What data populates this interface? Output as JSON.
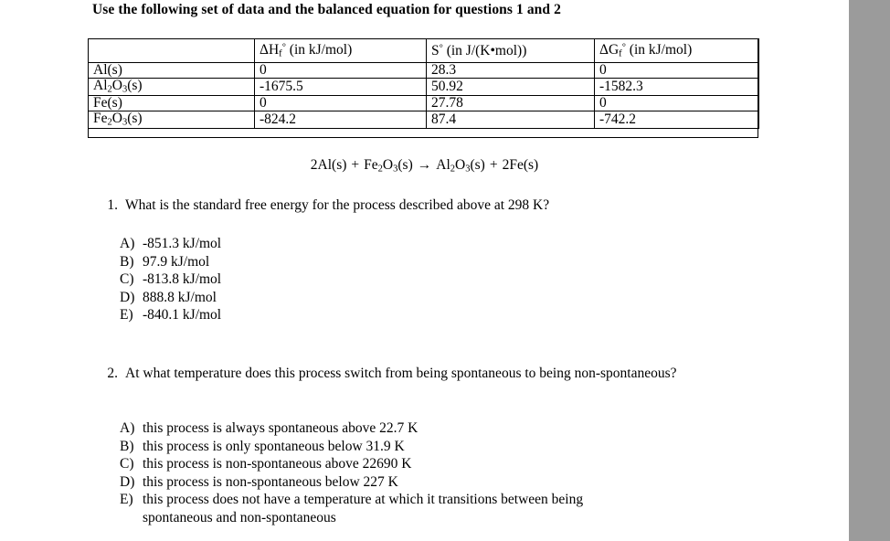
{
  "document": {
    "heading": "Use the following set of data and the balanced equation for questions 1 and 2",
    "gray_bar_color": "#9b9b9b",
    "background_color": "#ffffff",
    "text_color": "#000000"
  },
  "table": {
    "headers": [
      "",
      "ΔHf° (in kJ/mol)",
      "S° (in J/(K•mol))",
      "ΔGf° (in kJ/mol)"
    ],
    "header_parts": {
      "col0": "",
      "col1": {
        "symbol": "ΔH",
        "sub": "f",
        "sup": "°",
        "units": " (in kJ/mol)"
      },
      "col2": {
        "symbol": "S",
        "sub": "",
        "sup": "°",
        "units": "  (in J/(K•mol))"
      },
      "col3": {
        "symbol": "ΔG",
        "sub": "f",
        "sup": "°",
        "units": " (in kJ/mol)"
      }
    },
    "rows": [
      {
        "species_plain": "Al(s)",
        "species": {
          "pre": "Al(s)",
          "sub": "",
          "post": ""
        },
        "dHf": "0",
        "S": "28.3",
        "dGf": "0"
      },
      {
        "species_plain": "Al2O3(s)",
        "species": {
          "pre": "Al",
          "sub": "2",
          "mid": "O",
          "sub2": "3",
          "post": "(s)"
        },
        "dHf": "-1675.5",
        "S": "50.92",
        "dGf": "-1582.3"
      },
      {
        "species_plain": "Fe(s)",
        "species": {
          "pre": "Fe(s)",
          "sub": "",
          "post": ""
        },
        "dHf": "0",
        "S": "27.78",
        "dGf": "0"
      },
      {
        "species_plain": "Fe2O3(s)",
        "species": {
          "pre": "Fe",
          "sub": "2",
          "mid": "O",
          "sub2": "3",
          "post": "(s)"
        },
        "dHf": "-824.2",
        "S": "87.4",
        "dGf": "-742.2"
      }
    ]
  },
  "equation": {
    "full": "2Al(s)  +  Fe2O3(s) → Al2O3(s)  +  2Fe(s)",
    "r1_pre": "2Al(s)",
    "plus1": "+",
    "r2_pre": "Fe",
    "r2_sub1": "2",
    "r2_mid": "O",
    "r2_sub2": "3",
    "r2_post": "(s)",
    "arrow": "→",
    "p1_pre": "Al",
    "p1_sub1": "2",
    "p1_mid": "O",
    "p1_sub2": "3",
    "p1_post": "(s)",
    "plus2": "+",
    "p2_pre": "2Fe(s)"
  },
  "questions": [
    {
      "number": "1.",
      "text": "What is the standard free energy for the process described above at 298 K?",
      "choices": [
        {
          "label": "A)",
          "text": "-851.3 kJ/mol"
        },
        {
          "label": "B)",
          "text": "97.9 kJ/mol"
        },
        {
          "label": "C)",
          "text": "-813.8 kJ/mol"
        },
        {
          "label": "D)",
          "text": "888.8 kJ/mol"
        },
        {
          "label": "E)",
          "text": "-840.1 kJ/mol"
        }
      ]
    },
    {
      "number": "2.",
      "text": "At what temperature does this process switch from being spontaneous to being non-spontaneous?",
      "choices": [
        {
          "label": "A)",
          "text": "this process is always spontaneous above 22.7 K",
          "continuation": ""
        },
        {
          "label": "B)",
          "text": "this process is only spontaneous below 31.9 K",
          "continuation": ""
        },
        {
          "label": "C)",
          "text": "this process is non-spontaneous above 22690 K",
          "continuation": ""
        },
        {
          "label": "D)",
          "text": "this process is non-spontaneous below 227 K",
          "continuation": ""
        },
        {
          "label": "E)",
          "text": "this process does not have a temperature at which it transitions between being",
          "continuation": "spontaneous and non-spontaneous"
        }
      ]
    }
  ]
}
